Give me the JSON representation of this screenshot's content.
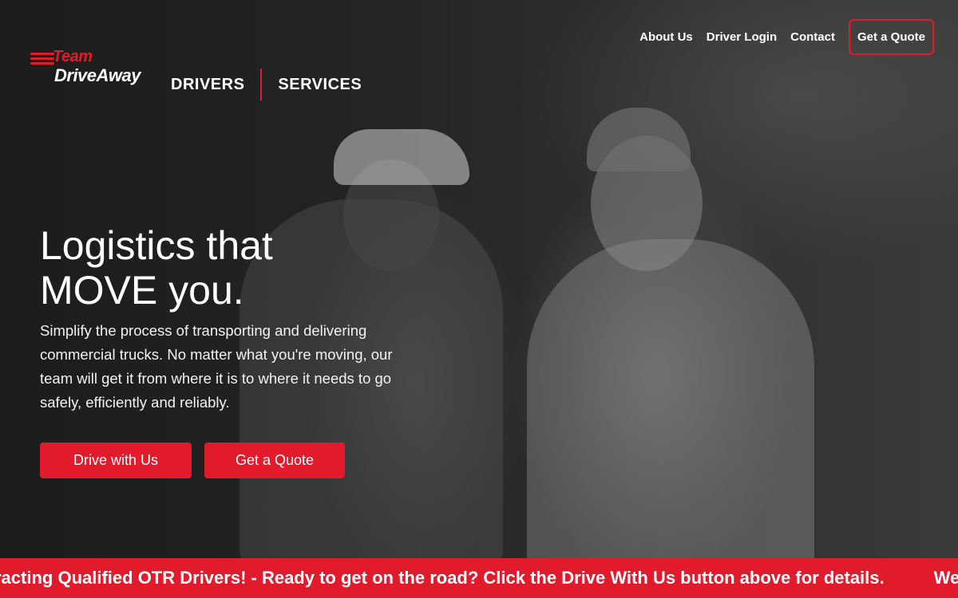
{
  "brand": {
    "logo_team": "Team",
    "logo_drive": "DriveAway",
    "accent_color": "#e21b2c"
  },
  "top_nav": {
    "items": [
      "About Us",
      "Driver Login",
      "Contact"
    ],
    "quote_label": "Get a Quote"
  },
  "main_nav": {
    "items": [
      "DRIVERS",
      "SERVICES"
    ]
  },
  "hero": {
    "headline_line1": "Logistics that",
    "headline_line2": "MOVE you.",
    "subtext": "Simplify the process of transporting and delivering commercial trucks. No matter what you're moving, our team will get it from where it is to where it needs to go safely, efficiently and reliably.",
    "primary_cta": "Drive with Us",
    "secondary_cta": "Get a Quote"
  },
  "ticker": {
    "message_1": "racting Qualified OTR Drivers! - Ready to get on the road? Click the Drive With Us button above for details.",
    "message_2": "We"
  }
}
